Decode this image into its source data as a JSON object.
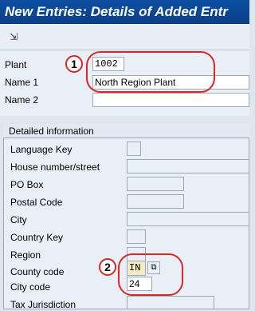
{
  "window": {
    "title": "New Entries: Details of Added Entr"
  },
  "toolbar": {
    "icon": "expand-icon"
  },
  "header_fields": {
    "plant": {
      "label": "Plant",
      "value": "1002"
    },
    "name1": {
      "label": "Name 1",
      "value": "North Region Plant"
    },
    "name2": {
      "label": "Name 2",
      "value": ""
    }
  },
  "detail": {
    "title": "Detailed information",
    "fields": [
      {
        "label": "Language Key",
        "value": ""
      },
      {
        "label": "House number/street",
        "value": ""
      },
      {
        "label": "PO Box",
        "value": ""
      },
      {
        "label": "Postal Code",
        "value": ""
      },
      {
        "label": "City",
        "value": ""
      },
      {
        "label": "Country Key",
        "value": ""
      },
      {
        "label": "Region",
        "value": ""
      },
      {
        "label": "County code",
        "value": "IN"
      },
      {
        "label": "City code",
        "value": "24"
      },
      {
        "label": "Tax Jurisdiction",
        "value": ""
      }
    ]
  },
  "callouts": {
    "one": "1",
    "two": "2"
  },
  "colors": {
    "title_bar": "#0d4fa3",
    "callout": "#d62828"
  }
}
